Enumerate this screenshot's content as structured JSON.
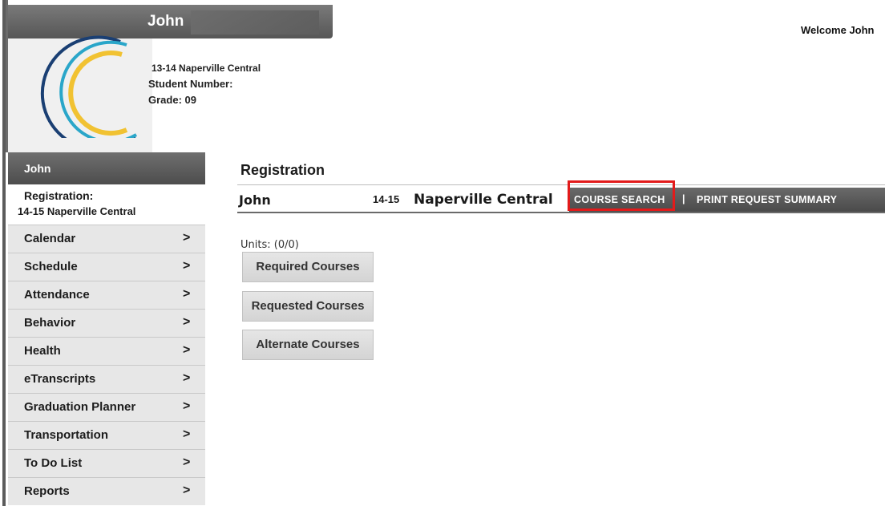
{
  "header": {
    "student_name": "John",
    "welcome": "Welcome John",
    "school_line": "13-14 Naperville Central",
    "student_number_label": "Student Number:",
    "grade": "Grade: 09"
  },
  "sidebar": {
    "title": "John",
    "registration_label": "Registration:",
    "registration_school": "14-15  Naperville Central",
    "items": [
      {
        "label": "Calendar",
        "icon": "chevron-right-icon"
      },
      {
        "label": "Schedule",
        "icon": "chevron-right-icon"
      },
      {
        "label": "Attendance",
        "icon": "chevron-right-icon"
      },
      {
        "label": "Behavior",
        "icon": "chevron-right-icon"
      },
      {
        "label": "Health",
        "icon": "chevron-right-icon"
      },
      {
        "label": "eTranscripts",
        "icon": "chevron-right-icon"
      },
      {
        "label": "Graduation Planner",
        "icon": "chevron-right-icon"
      },
      {
        "label": "Transportation",
        "icon": "chevron-right-icon"
      },
      {
        "label": "To Do List",
        "icon": "chevron-right-icon"
      },
      {
        "label": "Reports",
        "icon": "chevron-right-icon"
      }
    ],
    "chevron": ">"
  },
  "main": {
    "title": "Registration",
    "student": "John",
    "year": "14-15",
    "school": "Naperville Central",
    "actions": {
      "course_search": "COURSE SEARCH",
      "separator": "|",
      "print_summary": "PRINT REQUEST SUMMARY"
    },
    "units": "Units: (0/0)",
    "course_buttons": [
      "Required Courses",
      "Requested Courses",
      "Alternate Courses"
    ]
  },
  "colors": {
    "highlight": "#e21b1b",
    "logo_blue": "#1a3f73",
    "logo_teal": "#2aa6c9",
    "logo_yellow": "#f1c232"
  }
}
